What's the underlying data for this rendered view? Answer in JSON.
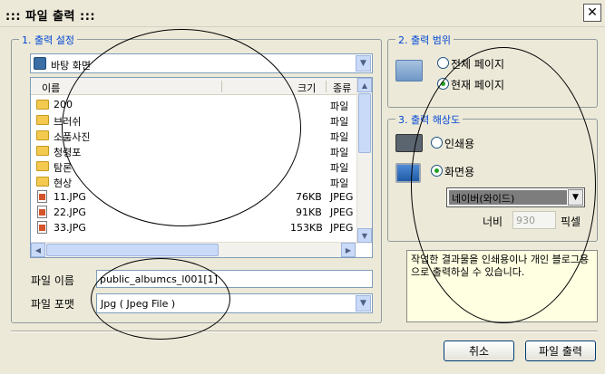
{
  "window": {
    "title": "::: 파일 출력 :::",
    "close_label": "✕"
  },
  "output_settings": {
    "group_title": "1. 출력 설정",
    "location": "바탕 화면",
    "columns": [
      "이름",
      "크기",
      "종류"
    ],
    "files": [
      {
        "name": "200",
        "size": "",
        "type": "파일",
        "kind": "folder"
      },
      {
        "name": "브러쉬",
        "size": "",
        "type": "파일",
        "kind": "folder"
      },
      {
        "name": "소품사진",
        "size": "",
        "type": "파일",
        "kind": "folder"
      },
      {
        "name": "청령포",
        "size": "",
        "type": "파일",
        "kind": "folder"
      },
      {
        "name": "탐론",
        "size": "",
        "type": "파일",
        "kind": "folder"
      },
      {
        "name": "현상",
        "size": "",
        "type": "파일",
        "kind": "folder"
      },
      {
        "name": "11.JPG",
        "size": "76KB",
        "type": "JPEG",
        "kind": "file"
      },
      {
        "name": "22.JPG",
        "size": "91KB",
        "type": "JPEG",
        "kind": "file"
      },
      {
        "name": "33.JPG",
        "size": "153KB",
        "type": "JPEG",
        "kind": "file"
      }
    ],
    "file_name_label": "파일 이름",
    "file_name_value": "public_albumcs_l001[1]",
    "file_format_label": "파일 포맷",
    "file_format_value": "Jpg  ( Jpeg File )"
  },
  "output_range": {
    "group_title": "2. 출력 범위",
    "options": [
      "전체 페이지",
      "현재 페이지"
    ],
    "selected": 1
  },
  "output_resolution": {
    "group_title": "3. 출력 해상도",
    "print_label": "인쇄용",
    "screen_label": "화면용",
    "selected": "screen",
    "preset_value": "네이버(와이드)",
    "width_label": "너비",
    "width_value": "930",
    "width_unit": "픽셀"
  },
  "info_text": "작업한 결과물을 인쇄용이나 개인 블로그용으로 출력하실 수 있습니다.",
  "buttons": {
    "cancel": "취소",
    "export": "파일 출력"
  }
}
